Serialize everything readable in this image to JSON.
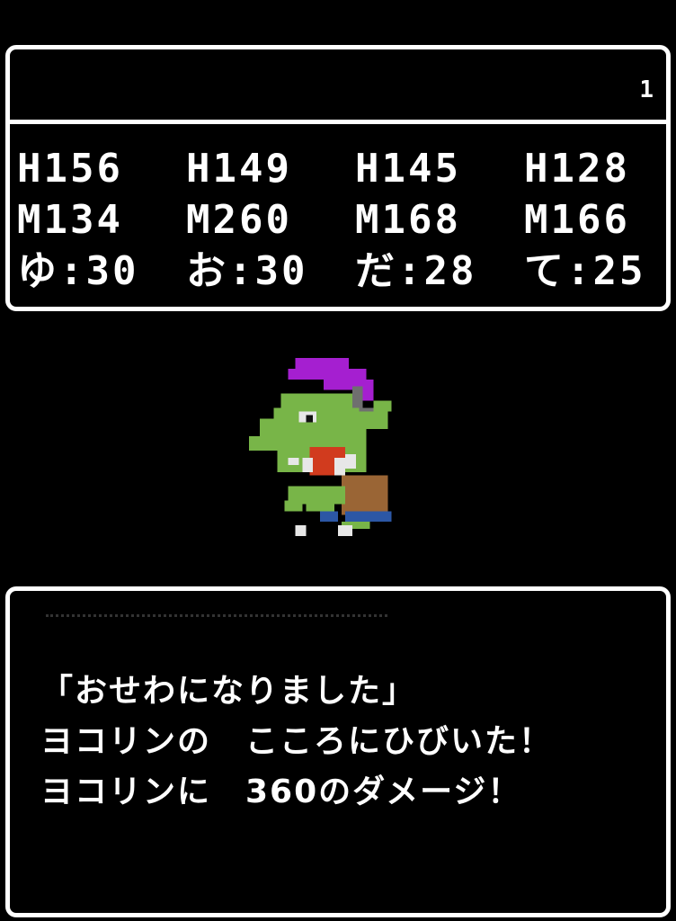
{
  "status": {
    "header_value": "1",
    "party": [
      {
        "hp": "H156",
        "mp": "M134",
        "level": "ゆ:30"
      },
      {
        "hp": "H149",
        "mp": "M260",
        "level": "お:30"
      },
      {
        "hp": "H145",
        "mp": "M168",
        "level": "だ:28"
      },
      {
        "hp": "H128",
        "mp": "M166",
        "level": "て:25"
      }
    ]
  },
  "enemy": {
    "sprite_icon": "goblin-sprite-icon",
    "colors": {
      "hair": "#a51fd0",
      "skin": "#78b548",
      "mouth": "#d13b1e",
      "helmet": "#6f6f6f",
      "bag": "#9a6535",
      "pants": "#2c57a5"
    }
  },
  "message": {
    "lines": [
      "「おせわになりました」",
      "ヨコリンの　こころにひびいた！",
      "ヨコリンに　360のダメージ！"
    ]
  },
  "colors": {
    "background": "#000000",
    "window_border": "#ffffff",
    "text": "#ffffff"
  }
}
